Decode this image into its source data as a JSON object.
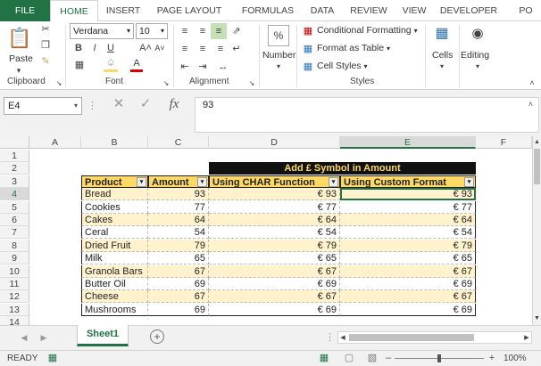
{
  "tabs": [
    "FILE",
    "HOME",
    "INSERT",
    "PAGE LAYOUT",
    "FORMULAS",
    "DATA",
    "REVIEW",
    "VIEW",
    "DEVELOPER",
    "PO"
  ],
  "clipboard": {
    "paste": "Paste",
    "label": "Clipboard"
  },
  "font": {
    "name": "Verdana",
    "size": "10",
    "label": "Font"
  },
  "alignment": {
    "label": "Alignment"
  },
  "number": {
    "label": "Number"
  },
  "styles": {
    "conditional": "Conditional Formatting",
    "format_table": "Format as Table",
    "cell_styles": "Cell Styles",
    "label": "Styles"
  },
  "cells": {
    "label": "Cells"
  },
  "editing": {
    "label": "Editing"
  },
  "formula_bar": {
    "name_box": "E4",
    "fx": "fx",
    "value": "93"
  },
  "columns": [
    "A",
    "B",
    "C",
    "D",
    "E",
    "F"
  ],
  "rows": [
    "1",
    "2",
    "3",
    "4",
    "5",
    "6",
    "7",
    "8",
    "9",
    "10",
    "11",
    "12",
    "13",
    "14"
  ],
  "table": {
    "merged_header": "Add £ Symbol in Amount",
    "headers": [
      "Product",
      "Amount",
      "Using CHAR Function",
      "Using Custom Format"
    ],
    "data": [
      [
        "Bread",
        "93",
        "€ 93",
        "€ 93"
      ],
      [
        "Cookies",
        "77",
        "€ 77",
        "€ 77"
      ],
      [
        "Cakes",
        "64",
        "€ 64",
        "€ 64"
      ],
      [
        "Ceral",
        "54",
        "€ 54",
        "€ 54"
      ],
      [
        "Dried Fruit",
        "79",
        "€ 79",
        "€ 79"
      ],
      [
        "Milk",
        "65",
        "€ 65",
        "€ 65"
      ],
      [
        "Granola Bars",
        "67",
        "€ 67",
        "€ 67"
      ],
      [
        "Butter Oil",
        "69",
        "€ 69",
        "€ 69"
      ],
      [
        "Cheese",
        "67",
        "€ 67",
        "€ 67"
      ],
      [
        "Mushrooms",
        "69",
        "€ 69",
        "€ 69"
      ]
    ]
  },
  "sheet_tab": "Sheet1",
  "status": {
    "ready": "READY",
    "zoom": "100%"
  },
  "colors": {
    "accent": "#217346",
    "header_fill": "#ffd966",
    "band_fill": "#fff2cc",
    "merged_fill": "#111111",
    "merged_text": "#ffd966"
  }
}
